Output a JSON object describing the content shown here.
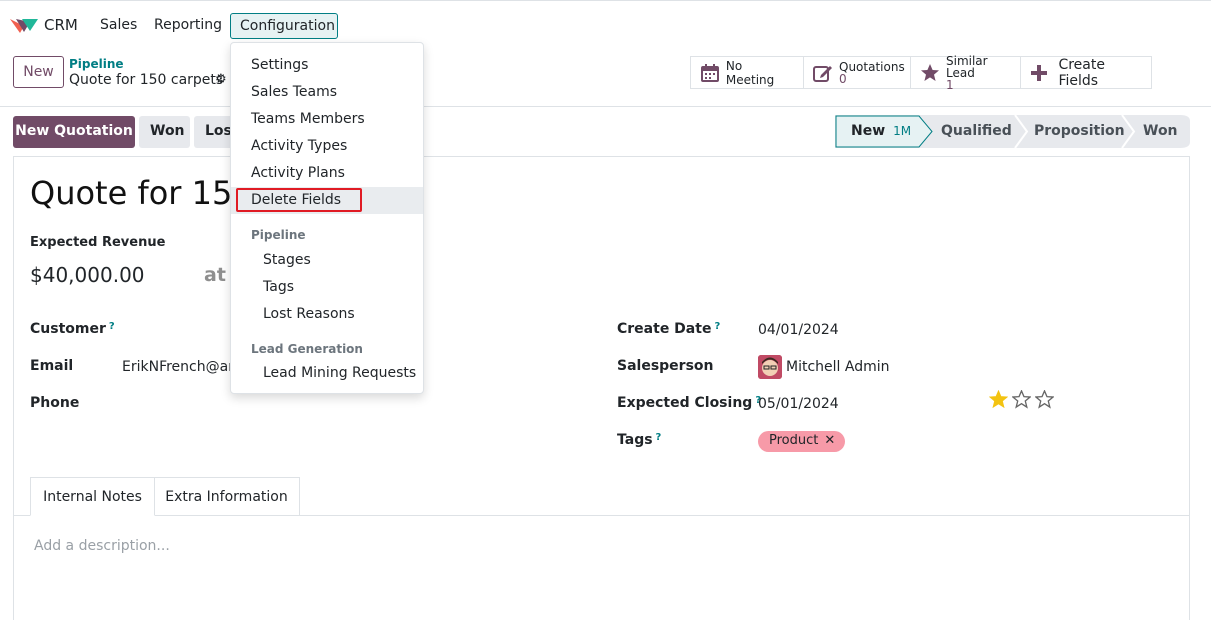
{
  "nav": {
    "app": "CRM",
    "items": [
      "Sales",
      "Reporting"
    ],
    "config": "Configuration"
  },
  "control": {
    "new_label": "New",
    "breadcrumb_parent": "Pipeline",
    "breadcrumb_current": "Quote for 150 carpets",
    "smart_buttons": {
      "meeting": "No Meeting",
      "quotations_label": "Quotations",
      "quotations_value": "0",
      "similar_label": "Similar Lead",
      "similar_value": "1",
      "create_fields": "Create Fields"
    }
  },
  "actions": {
    "new_quotation": "New Quotation",
    "won": "Won",
    "lost": "Lost"
  },
  "stages": {
    "items": [
      "New",
      "Qualified",
      "Proposition",
      "Won"
    ],
    "new_count": "1M",
    "active_color": "#e6f2f3"
  },
  "form": {
    "title": "Quote for 150 carpets",
    "expected_revenue_label": "Expected Revenue",
    "expected_revenue": "$40,000.00",
    "at_label": "at",
    "customer_label": "Customer",
    "email_label": "Email",
    "email_value": "ErikNFrench@armyspy.com",
    "phone_label": "Phone",
    "create_date_label": "Create Date",
    "create_date": "04/01/2024",
    "salesperson_label": "Salesperson",
    "salesperson": "Mitchell Admin",
    "expected_closing_label": "Expected Closing",
    "expected_closing": "05/01/2024",
    "priority_stars": 1,
    "tags_label": "Tags",
    "tag": "Product",
    "help_mark": "?"
  },
  "tabs": [
    "Internal Notes",
    "Extra Information"
  ],
  "description_placeholder": "Add a description...",
  "dropdown": {
    "items": [
      "Settings",
      "Sales Teams",
      "Teams Members",
      "Activity Types",
      "Activity Plans",
      "Delete Fields"
    ],
    "pipeline_header": "Pipeline",
    "pipeline_items": [
      "Stages",
      "Tags",
      "Lost Reasons"
    ],
    "lead_header": "Lead Generation",
    "lead_items": [
      "Lead Mining Requests"
    ]
  },
  "colors": {
    "brand": "#714b67",
    "accent": "#017e84",
    "highlight": "#e01b24",
    "tag": "#f79aa8",
    "star": "#f3c311"
  }
}
